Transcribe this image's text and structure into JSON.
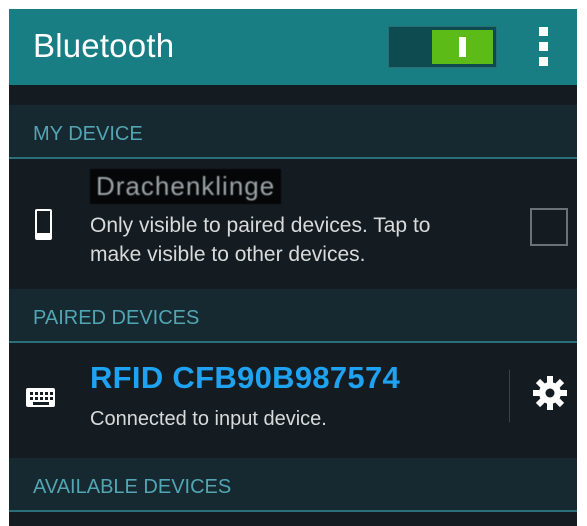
{
  "header": {
    "title": "Bluetooth",
    "toggle_state": "on",
    "toggle_color": "#5dbb17",
    "accent_color": "#197e84",
    "menu_icon": "overflow-menu-icon"
  },
  "sections": {
    "my_device": "MY DEVICE",
    "paired_devices": "PAIRED DEVICES",
    "available_devices": "AVAILABLE DEVICES"
  },
  "my_device": {
    "name": "Drachenklinge",
    "subtitle_line1": "Only visible to paired devices. Tap to",
    "subtitle_line2": "make visible to other devices.",
    "icon": "phone-icon",
    "visible_checked": false
  },
  "paired": [
    {
      "name": "RFID CFB90B987574",
      "status": "Connected to input device.",
      "icon": "keyboard-icon",
      "settings_icon": "gear-icon",
      "name_color": "#1ea2f1"
    }
  ]
}
